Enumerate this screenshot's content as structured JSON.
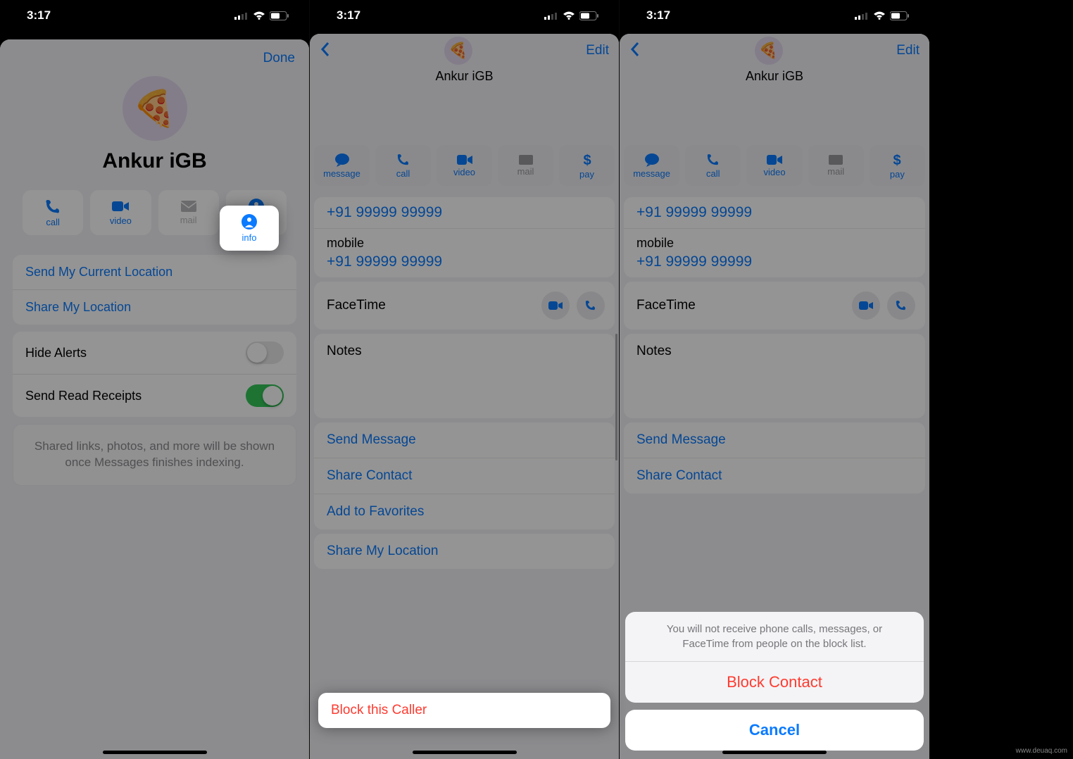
{
  "status": {
    "time": "3:17"
  },
  "screen1": {
    "done": "Done",
    "name": "Ankur iGB",
    "avatar_emoji": "🍕",
    "actions": {
      "call": "call",
      "video": "video",
      "mail": "mail",
      "info": "info"
    },
    "location_group": {
      "send_current": "Send My Current Location",
      "share": "Share My Location"
    },
    "toggles": {
      "hide_alerts": "Hide Alerts",
      "read_receipts": "Send Read Receipts"
    },
    "indexing_note": "Shared links, photos, and more will be shown once Messages finishes indexing."
  },
  "screen2": {
    "edit": "Edit",
    "name": "Ankur iGB",
    "avatar_emoji": "🍕",
    "actions": {
      "message": "message",
      "call": "call",
      "video": "video",
      "mail": "mail",
      "pay": "pay"
    },
    "phone_main": "+91 99999 99999",
    "mobile_label": "mobile",
    "phone_mobile": "+91 99999 99999",
    "facetime": "FaceTime",
    "notes": "Notes",
    "links": {
      "send_message": "Send Message",
      "share_contact": "Share Contact",
      "add_favorites": "Add to Favorites",
      "share_location": "Share My Location",
      "block": "Block this Caller"
    }
  },
  "screen3": {
    "sheet": {
      "message": "You will not receive phone calls, messages, or FaceTime from people on the block list.",
      "action": "Block Contact",
      "cancel": "Cancel"
    }
  },
  "watermark": "www.deuaq.com"
}
